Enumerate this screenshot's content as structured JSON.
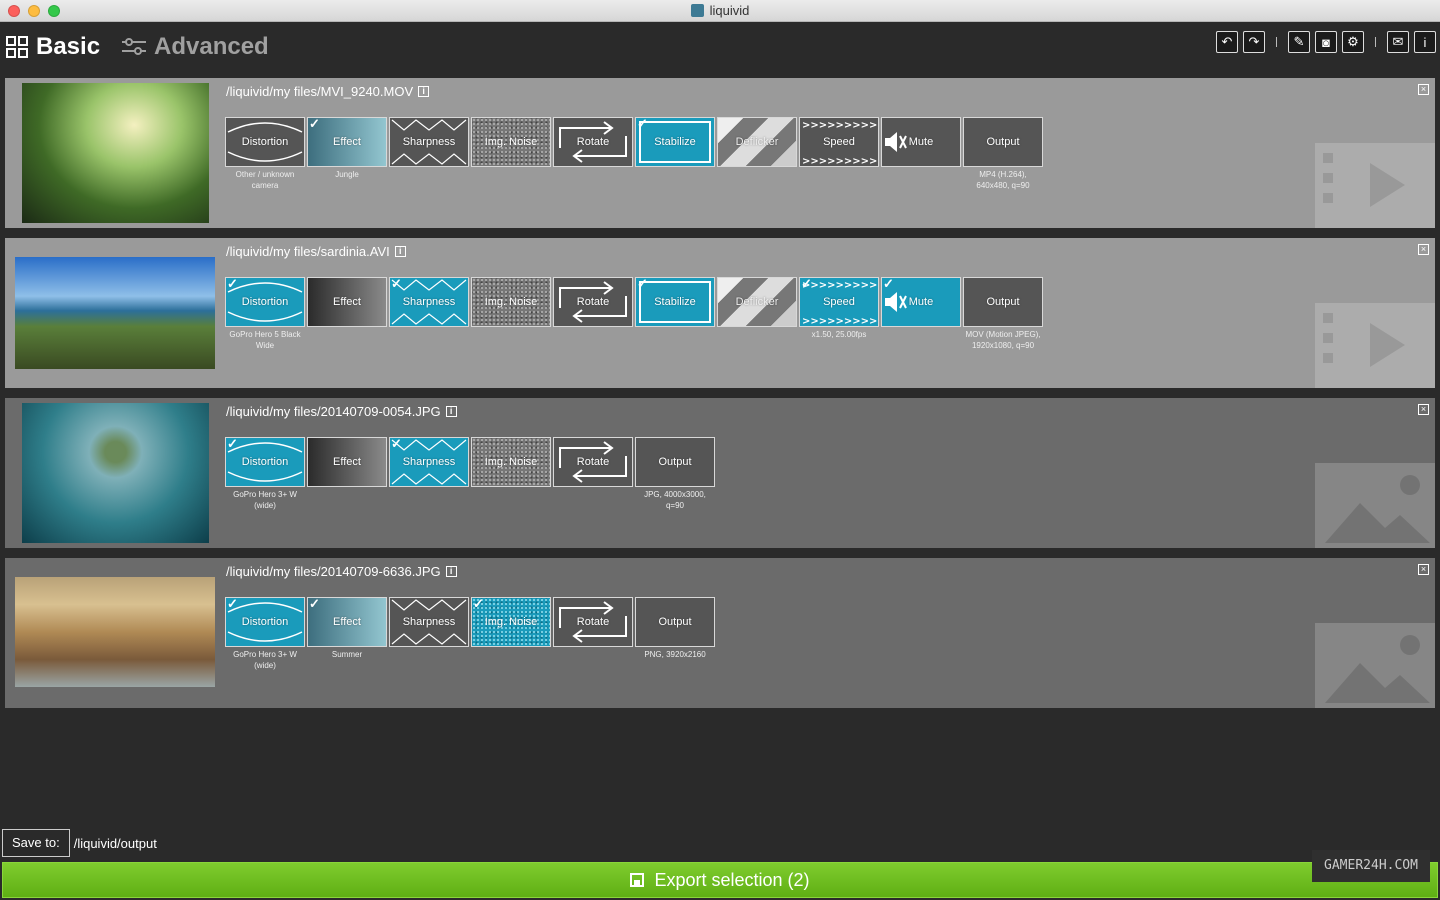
{
  "window": {
    "title": "liquivid"
  },
  "toolbar": {
    "basic_label": "Basic",
    "advanced_label": "Advanced",
    "buttons": [
      {
        "name": "undo-button",
        "glyph": "↶"
      },
      {
        "name": "redo-button",
        "glyph": "↷"
      },
      {
        "name": "edit-button",
        "glyph": "✎"
      },
      {
        "name": "snapshot-button",
        "glyph": "◙"
      },
      {
        "name": "settings-button",
        "glyph": "⚙"
      },
      {
        "name": "mail-button",
        "glyph": "✉"
      },
      {
        "name": "info-button",
        "glyph": "i"
      }
    ]
  },
  "files": [
    {
      "path": "/liquivid/my files/MVI_9240.MOV",
      "kind": "video",
      "tiles": [
        {
          "label": "Distortion",
          "style": "dark",
          "icon": "distortion",
          "checked": false,
          "caption": "Other / unknown camera"
        },
        {
          "label": "Effect",
          "style": "gradt",
          "checked": true,
          "caption": "Jungle"
        },
        {
          "label": "Sharpness",
          "style": "dark",
          "icon": "sharp",
          "checked": false,
          "caption": ""
        },
        {
          "label": "Img. Noise",
          "style": "noise",
          "checked": false,
          "caption": ""
        },
        {
          "label": "Rotate",
          "style": "dark",
          "icon": "rotate",
          "checked": false,
          "caption": ""
        },
        {
          "label": "Stabilize",
          "style": "teal",
          "icon": "stabilize",
          "checked": true,
          "caption": ""
        },
        {
          "label": "Deflicker",
          "style": "deflick",
          "checked": false,
          "caption": ""
        },
        {
          "label": "Speed",
          "style": "dark",
          "icon": "speed",
          "checked": false,
          "caption": ""
        },
        {
          "label": "Mute",
          "style": "dark",
          "icon": "mute",
          "checked": false,
          "caption": ""
        },
        {
          "label": "Output",
          "style": "dark",
          "checked": false,
          "caption": "MP4 (H.264), 640x480, q=90"
        }
      ]
    },
    {
      "path": "/liquivid/my files/sardinia.AVI",
      "kind": "video",
      "tiles": [
        {
          "label": "Distortion",
          "style": "teal",
          "icon": "distortion",
          "checked": true,
          "caption": "GoPro Hero 5 Black Wide"
        },
        {
          "label": "Effect",
          "style": "gradd",
          "checked": false,
          "caption": ""
        },
        {
          "label": "Sharpness",
          "style": "teal",
          "icon": "sharp",
          "checked": true,
          "caption": ""
        },
        {
          "label": "Img. Noise",
          "style": "noise",
          "checked": false,
          "caption": ""
        },
        {
          "label": "Rotate",
          "style": "dark",
          "icon": "rotate",
          "checked": false,
          "caption": ""
        },
        {
          "label": "Stabilize",
          "style": "teal",
          "icon": "stabilize",
          "checked": true,
          "caption": ""
        },
        {
          "label": "Deflicker",
          "style": "deflick",
          "checked": false,
          "caption": ""
        },
        {
          "label": "Speed",
          "style": "teal",
          "icon": "speed",
          "checked": true,
          "caption": "x1.50, 25.00fps"
        },
        {
          "label": "Mute",
          "style": "teal",
          "icon": "mute",
          "checked": true,
          "caption": ""
        },
        {
          "label": "Output",
          "style": "dark",
          "checked": false,
          "caption": "MOV (Motion JPEG), 1920x1080, q=90"
        }
      ]
    },
    {
      "path": "/liquivid/my files/20140709-0054.JPG",
      "kind": "image",
      "tiles": [
        {
          "label": "Distortion",
          "style": "teal",
          "icon": "distortion",
          "checked": true,
          "caption": "GoPro Hero 3+ W (wide)"
        },
        {
          "label": "Effect",
          "style": "gradd",
          "checked": false,
          "caption": ""
        },
        {
          "label": "Sharpness",
          "style": "teal",
          "icon": "sharp",
          "checked": true,
          "caption": ""
        },
        {
          "label": "Img. Noise",
          "style": "noise",
          "checked": false,
          "caption": ""
        },
        {
          "label": "Rotate",
          "style": "dark",
          "icon": "rotate",
          "checked": false,
          "caption": ""
        },
        {
          "label": "Output",
          "style": "dark",
          "checked": false,
          "caption": "JPG, 4000x3000, q=90"
        }
      ]
    },
    {
      "path": "/liquivid/my files/20140709-6636.JPG",
      "kind": "image",
      "tiles": [
        {
          "label": "Distortion",
          "style": "teal",
          "icon": "distortion",
          "checked": true,
          "caption": "GoPro Hero 3+ W (wide)"
        },
        {
          "label": "Effect",
          "style": "gradt",
          "checked": true,
          "caption": "Summer"
        },
        {
          "label": "Sharpness",
          "style": "dark",
          "icon": "sharp",
          "checked": false,
          "caption": ""
        },
        {
          "label": "Img. Noise",
          "style": "noise teal",
          "checked": true,
          "caption": ""
        },
        {
          "label": "Rotate",
          "style": "dark",
          "icon": "rotate",
          "checked": false,
          "caption": ""
        },
        {
          "label": "Output",
          "style": "dark",
          "checked": false,
          "caption": "PNG, 3920x2160"
        }
      ]
    }
  ],
  "save": {
    "button_label": "Save to:",
    "path": "/liquivid/output"
  },
  "export": {
    "label": "Export selection (2)"
  },
  "watermark": "GAMER24H.COM"
}
